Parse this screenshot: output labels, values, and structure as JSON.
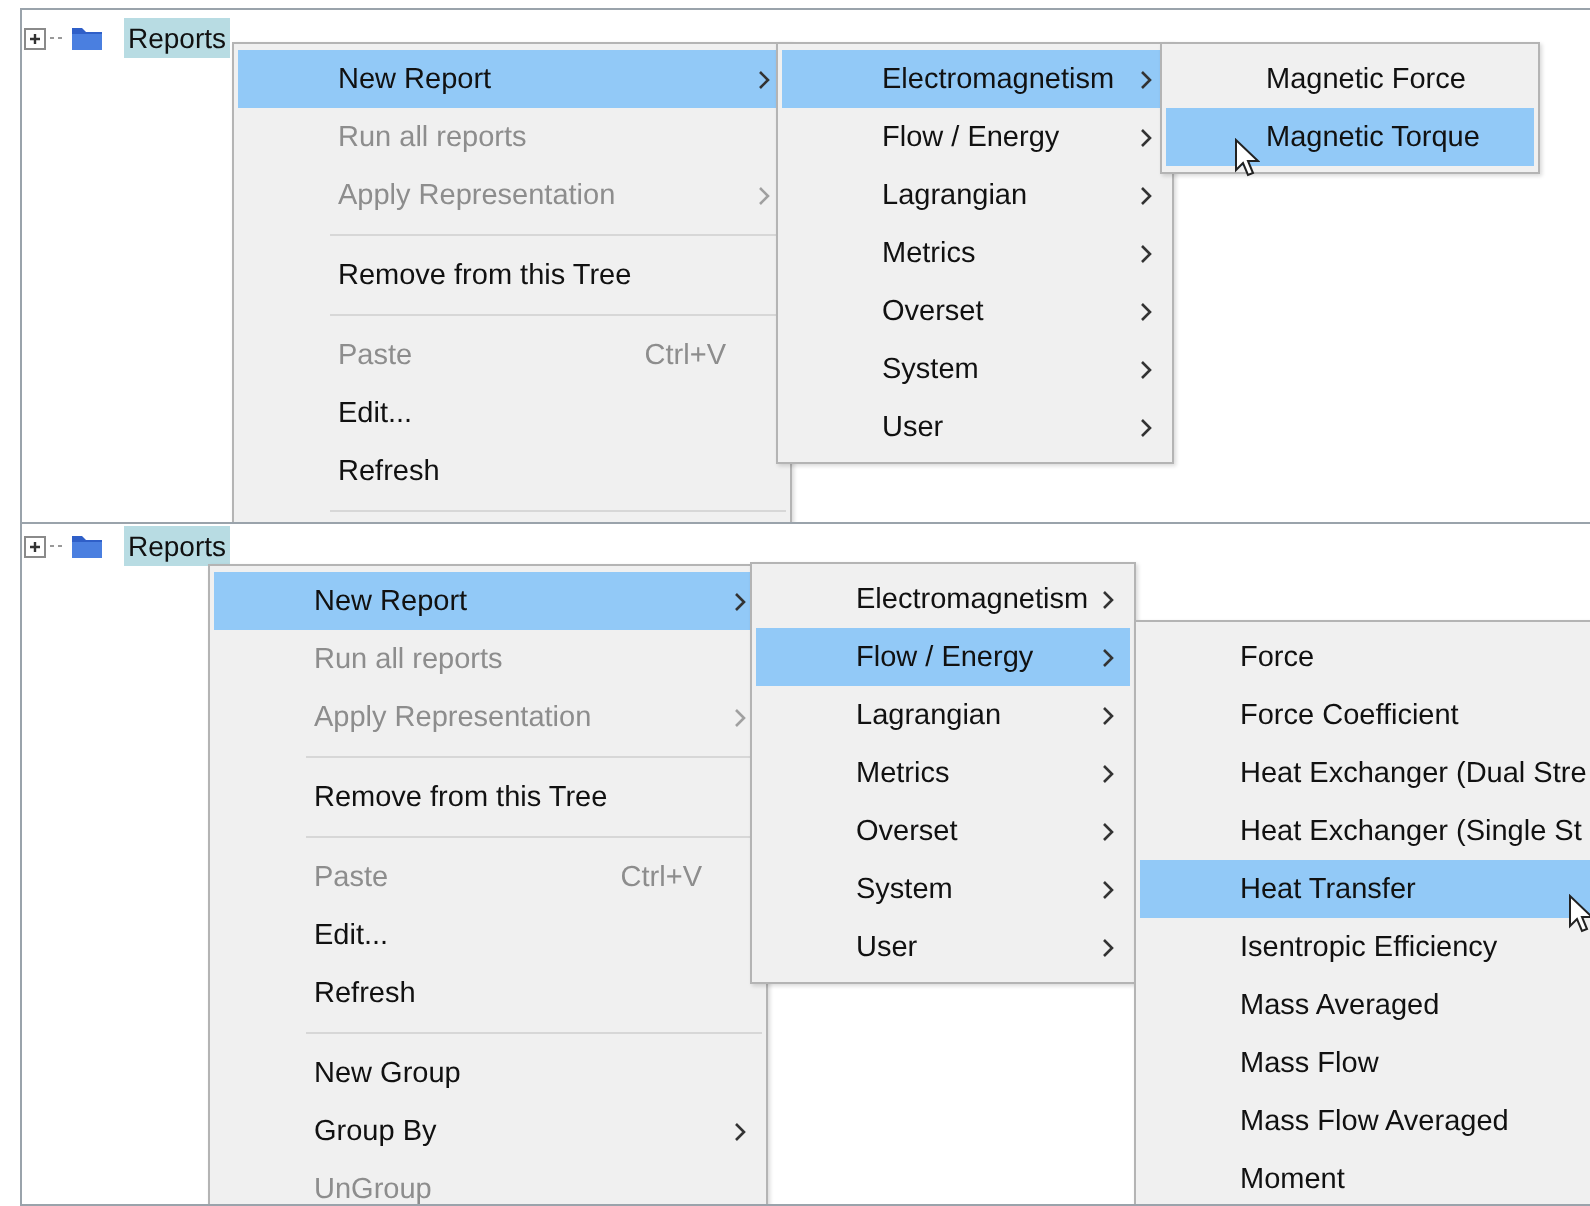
{
  "panels": [
    {
      "tree": {
        "label": "Reports",
        "selected": true
      },
      "menus": [
        {
          "items": [
            {
              "kind": "item",
              "label": "New Report",
              "submenu": true,
              "selected": true,
              "disabled": false
            },
            {
              "kind": "item",
              "label": "Run all reports",
              "submenu": false,
              "selected": false,
              "disabled": true
            },
            {
              "kind": "item",
              "label": "Apply Representation",
              "submenu": true,
              "selected": false,
              "disabled": true
            },
            {
              "kind": "separator"
            },
            {
              "kind": "item",
              "label": "Remove from this Tree",
              "submenu": false,
              "selected": false,
              "disabled": false
            },
            {
              "kind": "separator"
            },
            {
              "kind": "item",
              "label": "Paste",
              "shortcut": "Ctrl+V",
              "submenu": false,
              "selected": false,
              "disabled": true
            },
            {
              "kind": "item",
              "label": "Edit...",
              "submenu": false,
              "selected": false,
              "disabled": false
            },
            {
              "kind": "item",
              "label": "Refresh",
              "submenu": false,
              "selected": false,
              "disabled": false
            },
            {
              "kind": "separator"
            }
          ]
        },
        {
          "items": [
            {
              "kind": "item",
              "label": "Electromagnetism",
              "submenu": true,
              "selected": true,
              "disabled": false
            },
            {
              "kind": "item",
              "label": "Flow / Energy",
              "submenu": true,
              "selected": false,
              "disabled": false
            },
            {
              "kind": "item",
              "label": "Lagrangian",
              "submenu": true,
              "selected": false,
              "disabled": false
            },
            {
              "kind": "item",
              "label": "Metrics",
              "submenu": true,
              "selected": false,
              "disabled": false
            },
            {
              "kind": "item",
              "label": "Overset",
              "submenu": true,
              "selected": false,
              "disabled": false
            },
            {
              "kind": "item",
              "label": "System",
              "submenu": true,
              "selected": false,
              "disabled": false
            },
            {
              "kind": "item",
              "label": "User",
              "submenu": true,
              "selected": false,
              "disabled": false
            }
          ]
        },
        {
          "items": [
            {
              "kind": "item",
              "label": "Magnetic Force",
              "submenu": false,
              "selected": false,
              "disabled": false
            },
            {
              "kind": "item",
              "label": "Magnetic Torque",
              "submenu": false,
              "selected": true,
              "disabled": false
            }
          ]
        }
      ]
    },
    {
      "tree": {
        "label": "Reports",
        "selected": true
      },
      "menus": [
        {
          "items": [
            {
              "kind": "item",
              "label": "New Report",
              "submenu": true,
              "selected": true,
              "disabled": false
            },
            {
              "kind": "item",
              "label": "Run all reports",
              "submenu": false,
              "selected": false,
              "disabled": true
            },
            {
              "kind": "item",
              "label": "Apply Representation",
              "submenu": true,
              "selected": false,
              "disabled": true
            },
            {
              "kind": "separator"
            },
            {
              "kind": "item",
              "label": "Remove from this Tree",
              "submenu": false,
              "selected": false,
              "disabled": false
            },
            {
              "kind": "separator"
            },
            {
              "kind": "item",
              "label": "Paste",
              "shortcut": "Ctrl+V",
              "submenu": false,
              "selected": false,
              "disabled": true
            },
            {
              "kind": "item",
              "label": "Edit...",
              "submenu": false,
              "selected": false,
              "disabled": false
            },
            {
              "kind": "item",
              "label": "Refresh",
              "submenu": false,
              "selected": false,
              "disabled": false
            },
            {
              "kind": "separator"
            },
            {
              "kind": "item",
              "label": "New Group",
              "submenu": false,
              "selected": false,
              "disabled": false
            },
            {
              "kind": "item",
              "label": "Group By",
              "submenu": true,
              "selected": false,
              "disabled": false
            },
            {
              "kind": "item",
              "label": "UnGroup",
              "submenu": false,
              "selected": false,
              "disabled": true
            }
          ]
        },
        {
          "items": [
            {
              "kind": "item",
              "label": "Electromagnetism",
              "submenu": true,
              "selected": false,
              "disabled": false
            },
            {
              "kind": "item",
              "label": "Flow / Energy",
              "submenu": true,
              "selected": true,
              "disabled": false
            },
            {
              "kind": "item",
              "label": "Lagrangian",
              "submenu": true,
              "selected": false,
              "disabled": false
            },
            {
              "kind": "item",
              "label": "Metrics",
              "submenu": true,
              "selected": false,
              "disabled": false
            },
            {
              "kind": "item",
              "label": "Overset",
              "submenu": true,
              "selected": false,
              "disabled": false
            },
            {
              "kind": "item",
              "label": "System",
              "submenu": true,
              "selected": false,
              "disabled": false
            },
            {
              "kind": "item",
              "label": "User",
              "submenu": true,
              "selected": false,
              "disabled": false
            }
          ]
        },
        {
          "items": [
            {
              "kind": "item",
              "label": "Force",
              "submenu": false,
              "selected": false,
              "disabled": false
            },
            {
              "kind": "item",
              "label": "Force Coefficient",
              "submenu": false,
              "selected": false,
              "disabled": false
            },
            {
              "kind": "item",
              "label": "Heat Exchanger (Dual Stre",
              "submenu": false,
              "selected": false,
              "disabled": false
            },
            {
              "kind": "item",
              "label": "Heat Exchanger (Single St",
              "submenu": false,
              "selected": false,
              "disabled": false
            },
            {
              "kind": "item",
              "label": "Heat Transfer",
              "submenu": false,
              "selected": true,
              "disabled": false
            },
            {
              "kind": "item",
              "label": "Isentropic Efficiency",
              "submenu": false,
              "selected": false,
              "disabled": false
            },
            {
              "kind": "item",
              "label": "Mass Averaged",
              "submenu": false,
              "selected": false,
              "disabled": false
            },
            {
              "kind": "item",
              "label": "Mass Flow",
              "submenu": false,
              "selected": false,
              "disabled": false
            },
            {
              "kind": "item",
              "label": "Mass Flow Averaged",
              "submenu": false,
              "selected": false,
              "disabled": false
            },
            {
              "kind": "item",
              "label": "Moment",
              "submenu": false,
              "selected": false,
              "disabled": false
            }
          ]
        }
      ]
    }
  ]
}
